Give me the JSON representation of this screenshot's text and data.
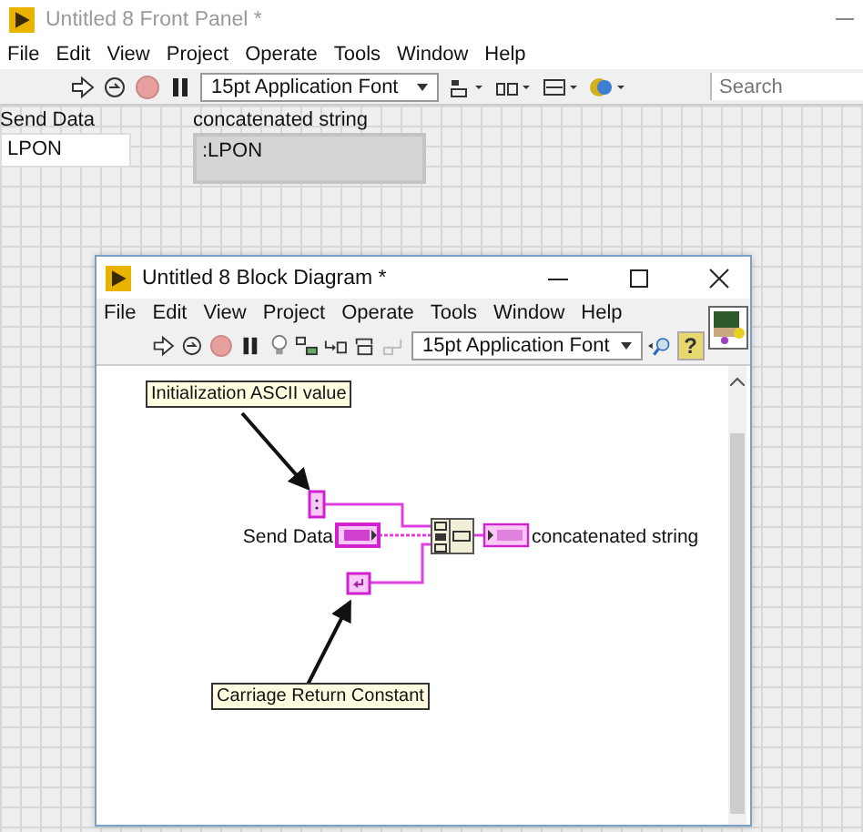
{
  "front_panel": {
    "title": "Untitled 8 Front Panel *",
    "menu": [
      "File",
      "Edit",
      "View",
      "Project",
      "Operate",
      "Tools",
      "Window",
      "Help"
    ],
    "font_select": "15pt Application Font",
    "search": {
      "placeholder": "Search"
    },
    "controls": [
      {
        "kind": "control",
        "label": "Send Data",
        "value": "LPON"
      },
      {
        "kind": "indicator",
        "label": "concatenated string",
        "value": ":LPON"
      }
    ]
  },
  "block_diagram": {
    "title": "Untitled 8 Block Diagram *",
    "menu": [
      "File",
      "Edit",
      "View",
      "Project",
      "Operate",
      "Tools",
      "Window",
      "Help"
    ],
    "font_select": "15pt Application Font",
    "help_button": "?",
    "control_label": "Send Data",
    "indicator_label": "concatenated string",
    "notes": [
      "Initialization ASCII value",
      "Carriage Return Constant"
    ]
  }
}
